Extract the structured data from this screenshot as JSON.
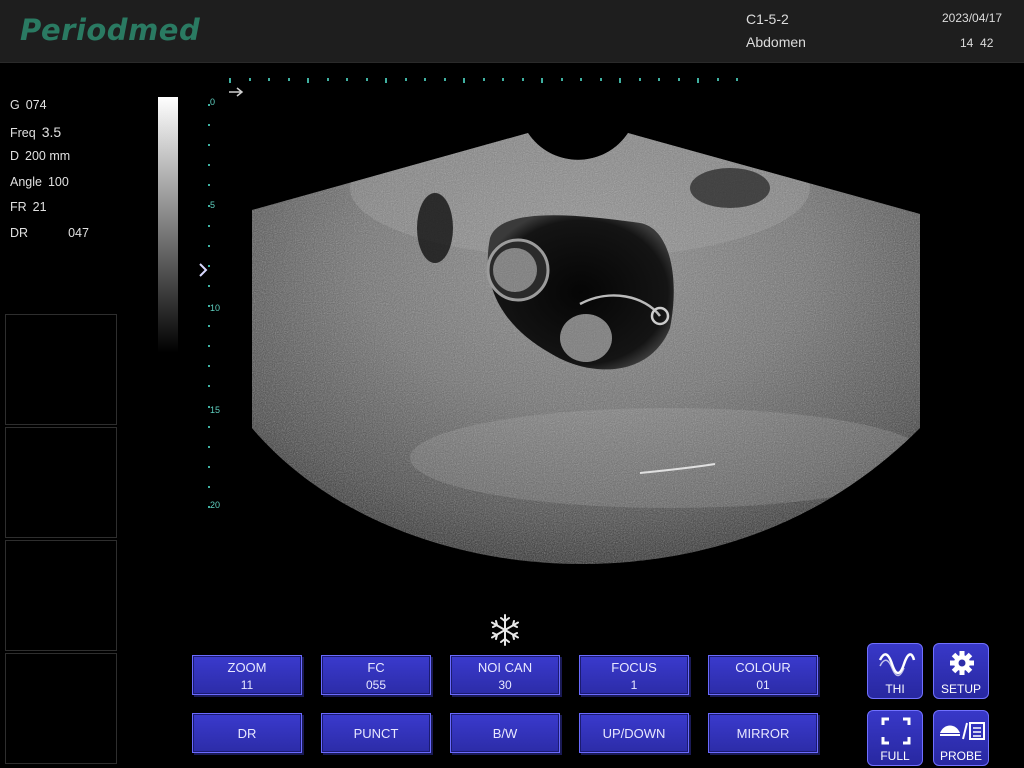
{
  "header": {
    "logo": "Periodmed",
    "preset": "C1-5-2",
    "exam": "Abdomen",
    "date": "2023/04/17",
    "time": "14  42"
  },
  "params": [
    {
      "key": "G",
      "value": "074"
    },
    {
      "key": "Freq",
      "value": "3.5"
    },
    {
      "key": "D",
      "value": "200 mm"
    },
    {
      "key": "Angle",
      "value": "100"
    },
    {
      "key": "FR",
      "value": "21"
    },
    {
      "key": "DR",
      "value": "047"
    }
  ],
  "depth_scale": [
    "0",
    "5",
    "10",
    "15",
    "20"
  ],
  "freeze_icon": "snowflake-icon",
  "controls": {
    "zoom": {
      "label": "ZOOM",
      "value": "11"
    },
    "fc": {
      "label": "FC",
      "value": "055"
    },
    "noi_can": {
      "label": "NOI CAN",
      "value": "30"
    },
    "focus": {
      "label": "FOCUS",
      "value": "1"
    },
    "colour": {
      "label": "COLOUR",
      "value": "01"
    },
    "dr": {
      "label": "DR"
    },
    "punct": {
      "label": "PUNCT"
    },
    "bw": {
      "label": "B/W"
    },
    "updown": {
      "label": "UP/DOWN"
    },
    "mirror": {
      "label": "MIRROR"
    }
  },
  "side_buttons": {
    "thi": {
      "label": "THI",
      "icon": "wave-icon"
    },
    "setup": {
      "label": "SETUP",
      "icon": "gear-icon"
    },
    "full": {
      "label": "FULL",
      "icon": "fullscreen-icon"
    },
    "probe": {
      "label": "PROBE",
      "icon": "probe-icon"
    }
  },
  "colors": {
    "accent": "#2c2ca8",
    "logo": "#2a7a62",
    "scale": "#3fb0a0"
  }
}
